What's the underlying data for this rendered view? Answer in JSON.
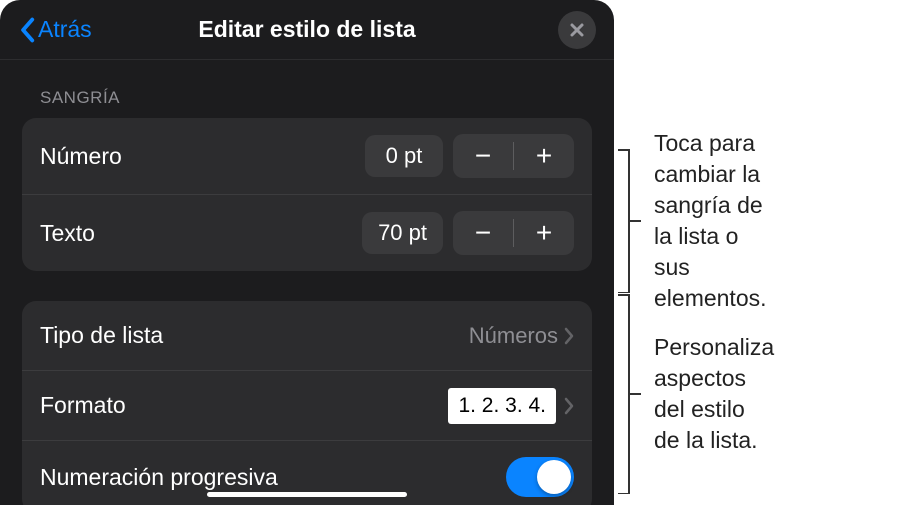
{
  "header": {
    "back": "Atrás",
    "title": "Editar estilo de lista"
  },
  "section_sangria": {
    "header": "SANGRÍA",
    "rows": {
      "numero": {
        "label": "Número",
        "value": "0 pt"
      },
      "texto": {
        "label": "Texto",
        "value": "70 pt"
      }
    }
  },
  "section_lista": {
    "tipo": {
      "label": "Tipo de lista",
      "value": "Números"
    },
    "formato": {
      "label": "Formato",
      "preview": "1. 2. 3. 4."
    },
    "numeracion": {
      "label": "Numeración progresiva",
      "on": true
    }
  },
  "callouts": {
    "sangria": "Toca para cambiar la sangría de la lista o sus elementos.",
    "estilo": "Personaliza aspectos del estilo de la lista."
  },
  "icons": {
    "minus": "−",
    "plus": "+"
  }
}
